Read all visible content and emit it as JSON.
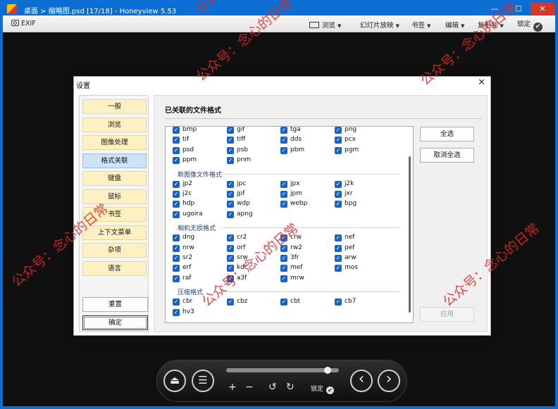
{
  "titlebar": {
    "title": "桌面 > 缩略图.psd [17/18] - Honeyview 5.53",
    "min_glyph": "—",
    "max_glyph": "☐",
    "close_glyph": "✕"
  },
  "toolbar": {
    "exif": "EXIF",
    "browse": "浏览",
    "slideshow": "幻灯片放映",
    "bookmark": "书签",
    "edit": "编辑",
    "copy_to": "复制到",
    "lock": "锁定"
  },
  "dialog": {
    "title": "设置",
    "close_glyph": "✕",
    "nav": [
      "一般",
      "浏览",
      "图像处理",
      "格式关联",
      "键盘",
      "鼠标",
      "书签",
      "上下文菜单",
      "杂项",
      "语言"
    ],
    "active_nav_index": 3,
    "reset": "重置",
    "ok": "确定",
    "section_title": "已关联的文件格式",
    "select_all": "全选",
    "deselect_all": "取消全选",
    "apply": "应用",
    "formats_top": [
      [
        "bmp",
        "gif",
        "tga",
        "png"
      ],
      [
        "tif",
        "tiff",
        "dds",
        "pcx"
      ],
      [
        "psd",
        "psb",
        "pbm",
        "pgm"
      ],
      [
        "ppm",
        "pnm"
      ]
    ],
    "groups": [
      {
        "title": "新图像文件格式",
        "rows": [
          [
            "jp2",
            "jpc",
            "jpx",
            "j2k"
          ],
          [
            "j2c",
            "jpf",
            "jpm",
            "jxr"
          ],
          [
            "hdp",
            "wdp",
            "webp",
            "bpg"
          ],
          [
            "ugoira",
            "apng"
          ]
        ]
      },
      {
        "title": "相机无损格式",
        "rows": [
          [
            "dng",
            "cr2",
            "crw",
            "nef"
          ],
          [
            "nrw",
            "orf",
            "rw2",
            "pef"
          ],
          [
            "sr2",
            "srw",
            "3fr",
            "arw"
          ],
          [
            "erf",
            "kdc",
            "mef",
            "mos"
          ],
          [
            "raf",
            "x3f",
            "mrw"
          ]
        ]
      },
      {
        "title": "压缩格式",
        "rows": [
          [
            "cbr",
            "cbz",
            "cbt",
            "cb7"
          ],
          [
            "hv3"
          ]
        ]
      }
    ]
  },
  "bottombar": {
    "eject_glyph": "⏏",
    "menu_glyph": "☰",
    "zoom_in": "+",
    "zoom_out": "−",
    "rotate_left": "↺",
    "rotate_right": "↻",
    "lock": "锁定",
    "prev_glyph": "‹",
    "next_glyph": "›",
    "slider_fraction": 0.9
  },
  "watermark": "公众号：念心的日常",
  "colors": {
    "accent": "#0c6dd2",
    "checkbox": "#1a62c4",
    "nav_item": "#fdf1c4",
    "nav_active": "#cfe3f7",
    "watermark": "#e62828"
  }
}
